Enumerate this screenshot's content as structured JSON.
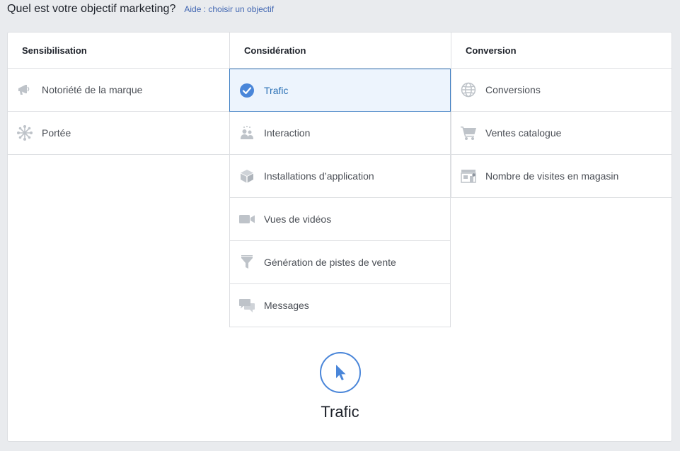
{
  "header": {
    "question": "Quel est votre objectif marketing?",
    "help_link": "Aide : choisir un objectif"
  },
  "columns": [
    {
      "title": "Sensibilisation",
      "items": [
        {
          "label": "Notoriété de la marque",
          "icon": "megaphone-icon"
        },
        {
          "label": "Portée",
          "icon": "reach-icon"
        }
      ]
    },
    {
      "title": "Considération",
      "items": [
        {
          "label": "Trafic",
          "icon": "check-circle-icon",
          "selected": true
        },
        {
          "label": "Interaction",
          "icon": "people-icon"
        },
        {
          "label": "Installations d’application",
          "icon": "box-icon"
        },
        {
          "label": "Vues de vidéos",
          "icon": "video-camera-icon"
        },
        {
          "label": "Génération de pistes de vente",
          "icon": "funnel-icon"
        },
        {
          "label": "Messages",
          "icon": "chat-bubbles-icon"
        }
      ]
    },
    {
      "title": "Conversion",
      "items": [
        {
          "label": "Conversions",
          "icon": "globe-icon"
        },
        {
          "label": "Ventes catalogue",
          "icon": "shopping-cart-icon"
        },
        {
          "label": "Nombre de visites en magasin",
          "icon": "store-icon"
        }
      ]
    }
  ],
  "selected_detail": {
    "title": "Trafic",
    "icon": "cursor-arrow-icon"
  },
  "colors": {
    "accent": "#4a86d9",
    "selected_bg": "#edf4fd",
    "icon_gray": "#bec3c9"
  }
}
